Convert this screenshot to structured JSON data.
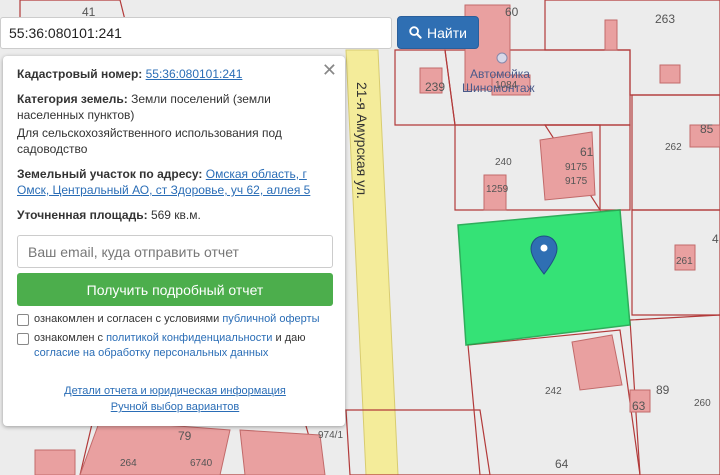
{
  "search": {
    "value": "55:36:080101:241",
    "button_label": "Найти"
  },
  "map": {
    "road_name": "21-я Амурская ул.",
    "poi_name_line1": "Автомойка",
    "poi_name_line2": "Шиномонтаж",
    "labels": {
      "n41": "41",
      "n60": "60",
      "n263": "263",
      "n239": "239",
      "n1084": "1084",
      "n240": "240",
      "n61": "61",
      "n9175a": "9175",
      "n9175b": "9175",
      "n262": "262",
      "n85": "85",
      "n1259": "1259",
      "n261": "261",
      "n242": "242",
      "n89": "89",
      "n63": "63",
      "n260": "260",
      "n64": "64",
      "n79": "79",
      "n264": "264",
      "n6740": "6740",
      "n974": "974/1",
      "n4a": "4"
    }
  },
  "panel": {
    "cadastral_label": "Кадастровый номер:",
    "cadastral_value": "55:36:080101:241",
    "category_label": "Категория земель:",
    "category_value": "Земли поселений (земли населенных пунктов)",
    "usage": "Для сельскохозяйственного использования под садоводство",
    "address_label": "Земельный участок по адресу:",
    "address_value": "Омская область, г Омск, Центральный АО, ст Здоровье, уч 62, аллея 5",
    "area_label": "Уточненная площадь:",
    "area_value": "569 кв.м.",
    "email_placeholder": "Ваш email, куда отправить отчет",
    "report_button": "Получить подробный отчет",
    "consent1_text": "ознакомлен и согласен с условиями ",
    "consent1_link": "публичной оферты",
    "consent2_text": "ознакомлен с ",
    "consent2_link1": "политикой конфиденциальности",
    "consent2_mid": " и даю",
    "consent2_link2": "согласие на обработку персональных данных",
    "details_link": "Детали отчета и юридическая информация",
    "manual_link": "Ручной выбор вариантов"
  }
}
